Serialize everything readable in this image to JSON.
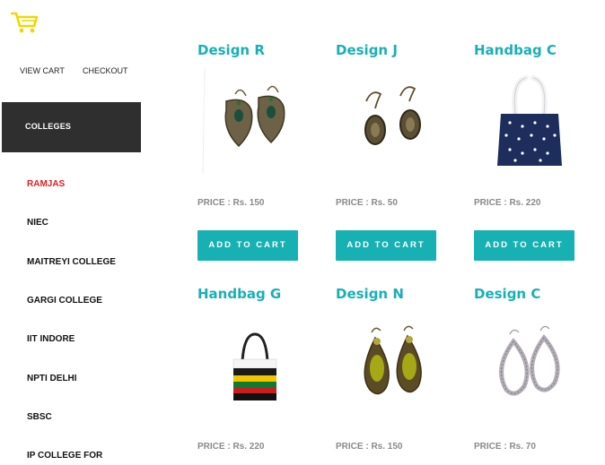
{
  "header": {
    "logo_icon": "shopping-cart-icon",
    "logo_color": "#f0d800"
  },
  "nav": {
    "view_cart": "VIEW CART",
    "checkout": "CHECKOUT"
  },
  "sidebar": {
    "heading": "COLLEGES",
    "items": [
      {
        "label": "RAMJAS",
        "active": true
      },
      {
        "label": "NIEC"
      },
      {
        "label": "MAITREYI COLLEGE"
      },
      {
        "label": "GARGI COLLEGE"
      },
      {
        "label": "IIT INDORE"
      },
      {
        "label": "NPTI DELHI"
      },
      {
        "label": "SBSC"
      },
      {
        "label": "IP COLLEGE FOR"
      }
    ]
  },
  "products": [
    {
      "title": "Design R",
      "price": "PRICE : Rs. 150",
      "button": "ADD TO CART",
      "image": "earrings-icon"
    },
    {
      "title": "Design J",
      "price": "PRICE : Rs. 50",
      "button": "ADD TO CART",
      "image": "earrings-icon"
    },
    {
      "title": "Handbag C",
      "price": "PRICE : Rs. 220",
      "button": "ADD TO CART",
      "image": "handbag-icon"
    },
    {
      "title": "Handbag G",
      "price": "PRICE : Rs. 220",
      "image": "handbag-icon"
    },
    {
      "title": "Design N",
      "price": "PRICE : Rs. 150",
      "image": "earrings-icon"
    },
    {
      "title": "Design C",
      "price": "PRICE : Rs. 70",
      "image": "earrings-icon"
    }
  ],
  "colors": {
    "accent": "#17b1b3",
    "title": "#1aafb5",
    "active": "#e0201f",
    "sidebar_bg": "#2f2f2f"
  }
}
